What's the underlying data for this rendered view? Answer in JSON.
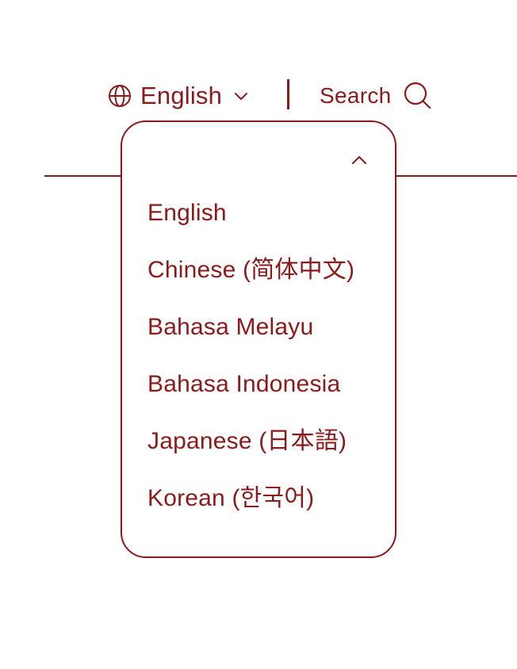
{
  "header": {
    "language_selector": {
      "icon": "globe-icon",
      "current_label": "English",
      "chevron_icon": "chevron-down-icon"
    },
    "search": {
      "label": "Search",
      "icon": "search-icon"
    }
  },
  "language_dropdown": {
    "collapse_icon": "chevron-up-icon",
    "options": [
      {
        "label": "English"
      },
      {
        "label": "Chinese (简体中文)"
      },
      {
        "label": "Bahasa Melayu"
      },
      {
        "label": "Bahasa Indonesia"
      },
      {
        "label": "Japanese (日本語)"
      },
      {
        "label": "Korean (한국어)"
      }
    ]
  },
  "colors": {
    "accent": "#8b1a1a",
    "background": "#ffffff"
  }
}
